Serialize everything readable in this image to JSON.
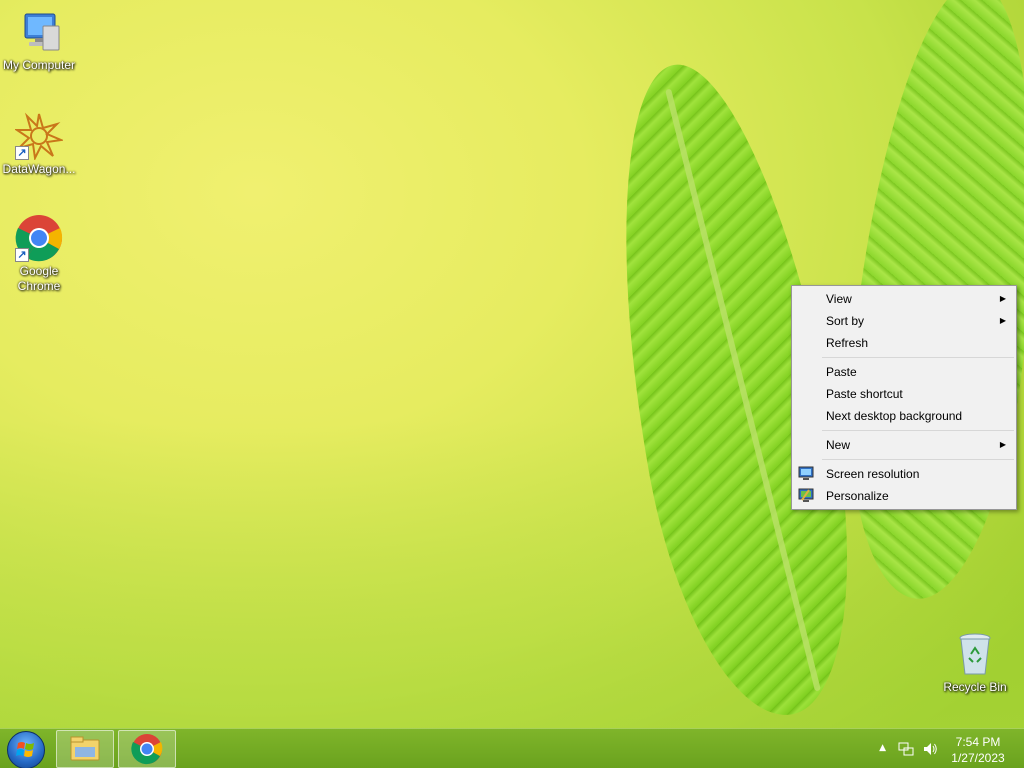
{
  "desktop": {
    "icons": [
      {
        "label": "My Computer"
      },
      {
        "label": "DataWagon..."
      },
      {
        "label": "Google Chrome"
      },
      {
        "label": "Recycle Bin"
      }
    ]
  },
  "context_menu": {
    "items": [
      {
        "label": "View",
        "submenu": true
      },
      {
        "label": "Sort by",
        "submenu": true
      },
      {
        "label": "Refresh"
      },
      {
        "label": "Paste"
      },
      {
        "label": "Paste shortcut"
      },
      {
        "label": "Next desktop background"
      },
      {
        "label": "New",
        "submenu": true
      },
      {
        "label": "Screen resolution",
        "icon": "monitor-icon"
      },
      {
        "label": "Personalize",
        "icon": "personalize-icon"
      }
    ],
    "submenu_glyph": "▶"
  },
  "taskbar": {
    "pinned": [
      {
        "name": "file-explorer",
        "icon": "folder-icon"
      },
      {
        "name": "google-chrome",
        "icon": "chrome-icon"
      }
    ],
    "tray": {
      "show_hidden_glyph": "▲",
      "time": "7:54 PM",
      "date": "1/27/2023"
    }
  },
  "colors": {
    "taskbar": "#6aa21e",
    "menu_bg": "#f1f1f1"
  }
}
